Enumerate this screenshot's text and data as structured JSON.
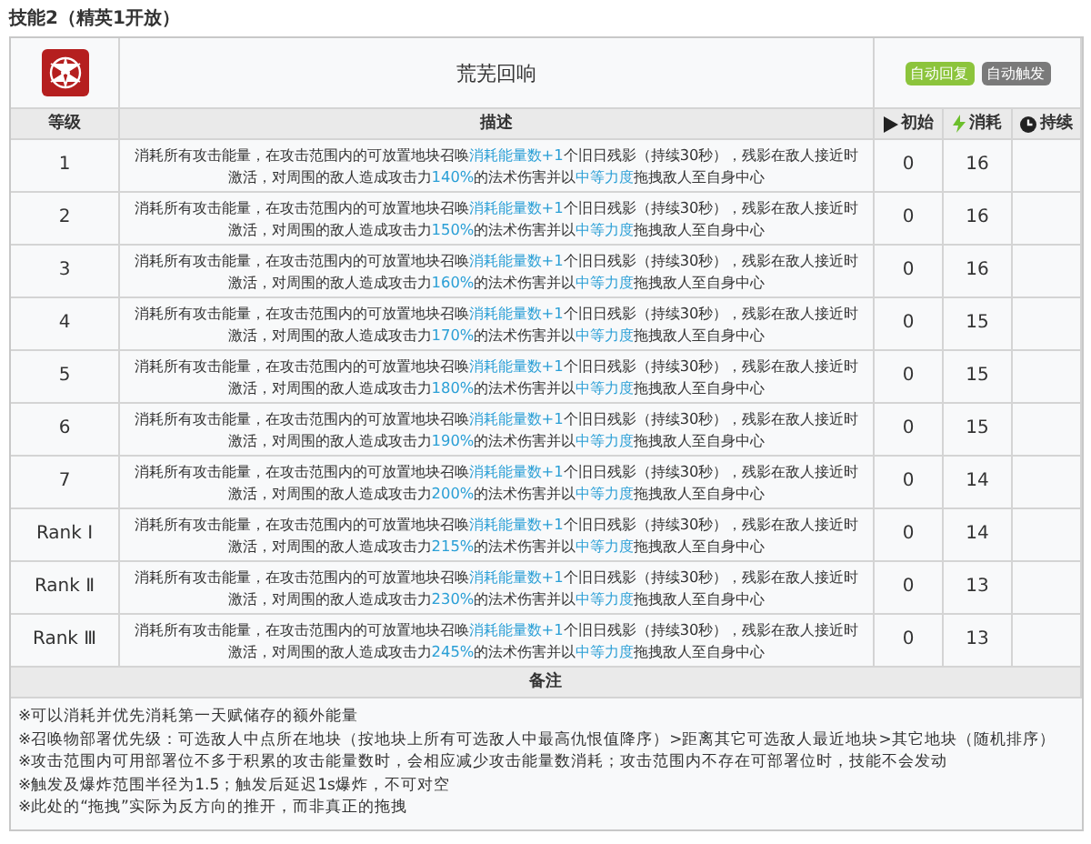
{
  "title": "技能2（精英1开放）",
  "skill": {
    "name": "荒芜回响",
    "tags": [
      {
        "label": "自动回复",
        "color": "#8cc43c"
      },
      {
        "label": "自动触发",
        "color": "#7a7a7a"
      }
    ]
  },
  "columns": [
    {
      "label": "等级"
    },
    {
      "label": "描述"
    },
    {
      "label": "初始"
    },
    {
      "label": "消耗"
    },
    {
      "label": "持续"
    }
  ],
  "rows": [
    {
      "level": "1",
      "description": [
        {
          "text": "消耗所有攻击能量，在攻击范围内的可放置地块召唤",
          "highlight": false
        },
        {
          "text": "消耗能量数+1",
          "highlight": true
        },
        {
          "text": "个旧日残影（持续30秒），残影在敌人接近时激活，对周围的敌人造成攻击力",
          "highlight": false
        },
        {
          "text": "140%",
          "highlight": true
        },
        {
          "text": "的法术伤害并以",
          "highlight": false
        },
        {
          "text": "中等力度",
          "highlight": true
        },
        {
          "text": "拖拽敌人至自身中心",
          "highlight": false
        }
      ],
      "initial": "0",
      "cost": "16"
    },
    {
      "level": "2",
      "description": [
        {
          "text": "消耗所有攻击能量，在攻击范围内的可放置地块召唤",
          "highlight": false
        },
        {
          "text": "消耗能量数+1",
          "highlight": true
        },
        {
          "text": "个旧日残影（持续30秒），残影在敌人接近时激活，对周围的敌人造成攻击力",
          "highlight": false
        },
        {
          "text": "150%",
          "highlight": true
        },
        {
          "text": "的法术伤害并以",
          "highlight": false
        },
        {
          "text": "中等力度",
          "highlight": true
        },
        {
          "text": "拖拽敌人至自身中心",
          "highlight": false
        }
      ],
      "initial": "0",
      "cost": "16"
    },
    {
      "level": "3",
      "description": [
        {
          "text": "消耗所有攻击能量，在攻击范围内的可放置地块召唤",
          "highlight": false
        },
        {
          "text": "消耗能量数+1",
          "highlight": true
        },
        {
          "text": "个旧日残影（持续30秒），残影在敌人接近时激活，对周围的敌人造成攻击力",
          "highlight": false
        },
        {
          "text": "160%",
          "highlight": true
        },
        {
          "text": "的法术伤害并以",
          "highlight": false
        },
        {
          "text": "中等力度",
          "highlight": true
        },
        {
          "text": "拖拽敌人至自身中心",
          "highlight": false
        }
      ],
      "initial": "0",
      "cost": "16"
    },
    {
      "level": "4",
      "description": [
        {
          "text": "消耗所有攻击能量，在攻击范围内的可放置地块召唤",
          "highlight": false
        },
        {
          "text": "消耗能量数+1",
          "highlight": true
        },
        {
          "text": "个旧日残影（持续30秒），残影在敌人接近时激活，对周围的敌人造成攻击力",
          "highlight": false
        },
        {
          "text": "170%",
          "highlight": true
        },
        {
          "text": "的法术伤害并以",
          "highlight": false
        },
        {
          "text": "中等力度",
          "highlight": true
        },
        {
          "text": "拖拽敌人至自身中心",
          "highlight": false
        }
      ],
      "initial": "0",
      "cost": "15"
    },
    {
      "level": "5",
      "description": [
        {
          "text": "消耗所有攻击能量，在攻击范围内的可放置地块召唤",
          "highlight": false
        },
        {
          "text": "消耗能量数+1",
          "highlight": true
        },
        {
          "text": "个旧日残影（持续30秒），残影在敌人接近时激活，对周围的敌人造成攻击力",
          "highlight": false
        },
        {
          "text": "180%",
          "highlight": true
        },
        {
          "text": "的法术伤害并以",
          "highlight": false
        },
        {
          "text": "中等力度",
          "highlight": true
        },
        {
          "text": "拖拽敌人至自身中心",
          "highlight": false
        }
      ],
      "initial": "0",
      "cost": "15"
    },
    {
      "level": "6",
      "description": [
        {
          "text": "消耗所有攻击能量，在攻击范围内的可放置地块召唤",
          "highlight": false
        },
        {
          "text": "消耗能量数+1",
          "highlight": true
        },
        {
          "text": "个旧日残影（持续30秒），残影在敌人接近时激活，对周围的敌人造成攻击力",
          "highlight": false
        },
        {
          "text": "190%",
          "highlight": true
        },
        {
          "text": "的法术伤害并以",
          "highlight": false
        },
        {
          "text": "中等力度",
          "highlight": true
        },
        {
          "text": "拖拽敌人至自身中心",
          "highlight": false
        }
      ],
      "initial": "0",
      "cost": "15"
    },
    {
      "level": "7",
      "description": [
        {
          "text": "消耗所有攻击能量，在攻击范围内的可放置地块召唤",
          "highlight": false
        },
        {
          "text": "消耗能量数+1",
          "highlight": true
        },
        {
          "text": "个旧日残影（持续30秒），残影在敌人接近时激活，对周围的敌人造成攻击力",
          "highlight": false
        },
        {
          "text": "200%",
          "highlight": true
        },
        {
          "text": "的法术伤害并以",
          "highlight": false
        },
        {
          "text": "中等力度",
          "highlight": true
        },
        {
          "text": "拖拽敌人至自身中心",
          "highlight": false
        }
      ],
      "initial": "0",
      "cost": "14"
    },
    {
      "level": "Rank Ⅰ",
      "description": [
        {
          "text": "消耗所有攻击能量，在攻击范围内的可放置地块召唤",
          "highlight": false
        },
        {
          "text": "消耗能量数+1",
          "highlight": true
        },
        {
          "text": "个旧日残影（持续30秒），残影在敌人接近时激活，对周围的敌人造成攻击力",
          "highlight": false
        },
        {
          "text": "215%",
          "highlight": true
        },
        {
          "text": "的法术伤害并以",
          "highlight": false
        },
        {
          "text": "中等力度",
          "highlight": true
        },
        {
          "text": "拖拽敌人至自身中心",
          "highlight": false
        }
      ],
      "initial": "0",
      "cost": "14"
    },
    {
      "level": "Rank Ⅱ",
      "description": [
        {
          "text": "消耗所有攻击能量，在攻击范围内的可放置地块召唤",
          "highlight": false
        },
        {
          "text": "消耗能量数+1",
          "highlight": true
        },
        {
          "text": "个旧日残影（持续30秒），残影在敌人接近时激活，对周围的敌人造成攻击力",
          "highlight": false
        },
        {
          "text": "230%",
          "highlight": true
        },
        {
          "text": "的法术伤害并以",
          "highlight": false
        },
        {
          "text": "中等力度",
          "highlight": true
        },
        {
          "text": "拖拽敌人至自身中心",
          "highlight": false
        }
      ],
      "initial": "0",
      "cost": "13"
    },
    {
      "level": "Rank Ⅲ",
      "description": [
        {
          "text": "消耗所有攻击能量，在攻击范围内的可放置地块召唤",
          "highlight": false
        },
        {
          "text": "消耗能量数+1",
          "highlight": true
        },
        {
          "text": "个旧日残影（持续30秒），残影在敌人接近时激活，对周围的敌人造成攻击力",
          "highlight": false
        },
        {
          "text": "245%",
          "highlight": true
        },
        {
          "text": "的法术伤害并以",
          "highlight": false
        },
        {
          "text": "中等力度",
          "highlight": true
        },
        {
          "text": "拖拽敌人至自身中心",
          "highlight": false
        }
      ],
      "initial": "0",
      "cost": "13"
    }
  ],
  "notes": {
    "heading": "备注",
    "lines": [
      "※可以消耗并优先消耗第一天赋储存的额外能量",
      "※召唤物部署优先级：可选敌人中点所在地块（按地块上所有可选敌人中最高仇恨值降序）>距离其它可选敌人最近地块>其它地块（随机排序）",
      "※攻击范围内可用部署位不多于积累的攻击能量数时，会相应减少攻击能量数消耗；攻击范围内不存在可部署位时，技能不会发动",
      "※触发及爆炸范围半径为1.5；触发后延迟1s爆炸，不可对空",
      "※此处的“拖拽”实际为反方向的推开，而非真正的拖拽"
    ]
  }
}
